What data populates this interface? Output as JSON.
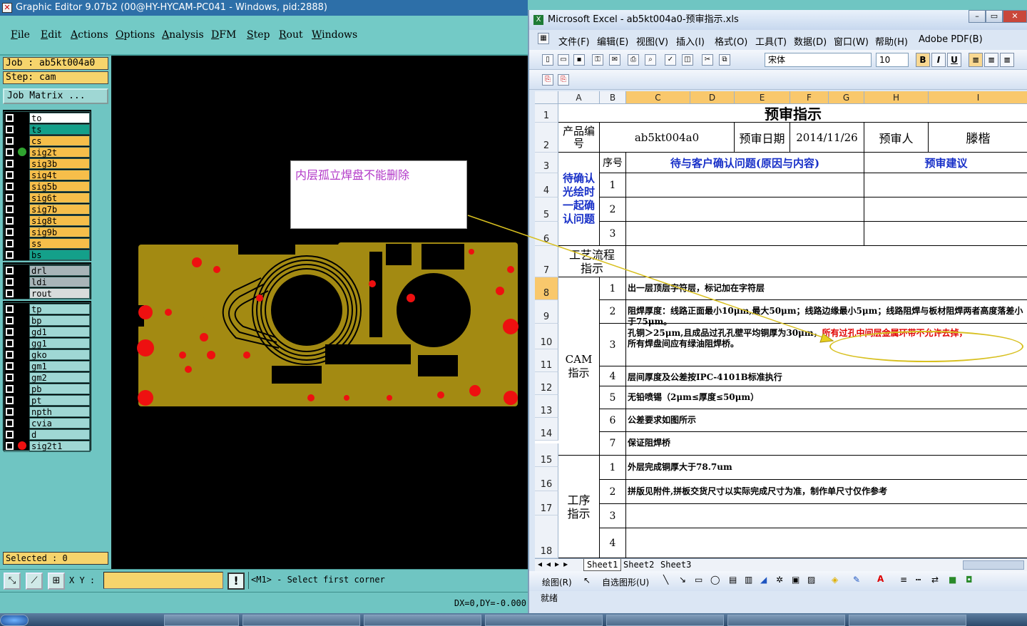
{
  "ge": {
    "title": "Graphic Editor 9.07b2 (00@HY-HYCAM-PC041 - Windows, pid:2888)",
    "menu": [
      "File",
      "Edit",
      "Actions",
      "Options",
      "Analysis",
      "DFM",
      "Step",
      "Rout",
      "Windows"
    ],
    "job": "Job : ab5kt004a0",
    "step": "Step: cam",
    "job_matrix": "Job Matrix ...",
    "layers_board": [
      {
        "name": "to",
        "color": "#ffffff"
      },
      {
        "name": "ts",
        "color": "#14a08a"
      },
      {
        "name": "cs",
        "color": "#f6be4a"
      },
      {
        "name": "sig2t",
        "color": "#f6be4a",
        "dot": "#2fa32f"
      },
      {
        "name": "sig3b",
        "color": "#f6be4a"
      },
      {
        "name": "sig4t",
        "color": "#f6be4a"
      },
      {
        "name": "sig5b",
        "color": "#f6be4a"
      },
      {
        "name": "sig6t",
        "color": "#f6be4a"
      },
      {
        "name": "sig7b",
        "color": "#f6be4a"
      },
      {
        "name": "sig8t",
        "color": "#f6be4a"
      },
      {
        "name": "sig9b",
        "color": "#f6be4a"
      },
      {
        "name": "ss",
        "color": "#f6be4a"
      },
      {
        "name": "bs",
        "color": "#14a08a"
      }
    ],
    "layers_drill": [
      {
        "name": "drl",
        "color": "#a8b4b8"
      },
      {
        "name": "ldi",
        "color": "#a8b4b8"
      },
      {
        "name": "rout",
        "color": "#d8dcdc"
      }
    ],
    "layers_misc": [
      {
        "name": "tp",
        "color": "#9fd7d4"
      },
      {
        "name": "bp",
        "color": "#9fd7d4"
      },
      {
        "name": "gd1",
        "color": "#9fd7d4"
      },
      {
        "name": "gg1",
        "color": "#9fd7d4"
      },
      {
        "name": "gko",
        "color": "#9fd7d4"
      },
      {
        "name": "gm1",
        "color": "#9fd7d4"
      },
      {
        "name": "gm2",
        "color": "#9fd7d4"
      },
      {
        "name": "pb",
        "color": "#9fd7d4"
      },
      {
        "name": "pt",
        "color": "#9fd7d4"
      },
      {
        "name": "npth",
        "color": "#9fd7d4"
      },
      {
        "name": "cvia",
        "color": "#9fd7d4"
      },
      {
        "name": "d",
        "color": "#9fd7d4"
      },
      {
        "name": "sig2t1",
        "color": "#9fd7d4",
        "dot": "#ee1010"
      }
    ],
    "selected": "Selected : 0",
    "annotation": "内层孤立焊盘不能删除",
    "xy_label": "X Y :",
    "prompt": "<M1> - Select first corner",
    "dxdy": "DX=0,DY=-0.000"
  },
  "xl": {
    "title": "Microsoft Excel - ab5kt004a0-预审指示.xls",
    "menu": [
      "文件(F)",
      "编辑(E)",
      "视图(V)",
      "插入(I)",
      "格式(O)",
      "工具(T)",
      "数据(D)",
      "窗口(W)",
      "帮助(H)",
      "Adobe PDF(B)"
    ],
    "font": "宋体",
    "size": "10",
    "columns": [
      "A",
      "B",
      "C",
      "D",
      "E",
      "F",
      "G",
      "H",
      "I"
    ],
    "rows": [
      "1",
      "2",
      "3",
      "4",
      "5",
      "6",
      "7",
      "8",
      "9",
      "10",
      "11",
      "12",
      "13",
      "14",
      "15",
      "16",
      "17",
      "18"
    ],
    "sheet": {
      "title": "预审指示",
      "product_label": "产品编号",
      "product_no": "ab5kt004a0",
      "date_label": "预审日期",
      "date": "2014/11/26",
      "reviewer_label": "预审人",
      "reviewer": "滕楷",
      "seq_label": "序号",
      "issue_header": "待与客户确认问题(原因与内容)",
      "suggest_header": "预审建议",
      "confirm_label": "待确认光绘时一起确认问题",
      "confirm_nums": [
        "1",
        "2",
        "3"
      ],
      "process_label": "工艺流程指示",
      "cam_label": "CAM指示",
      "cam_items": [
        {
          "n": "1",
          "t": "出一层顶层字符层，标记加在字符层"
        },
        {
          "n": "2",
          "t": "阻焊厚度：线路正面最小10μm,最大50μm；线路边缘最小5μm；线路阻焊与板材阻焊两者高度落差小于75μm。"
        },
        {
          "n": "3",
          "t": "孔铜＞25μm,且成品过孔孔壁平均铜厚为30μm，",
          "t_red": "所有过孔中间层金属环带不允许去掉，",
          "t2": "所有焊盘间应有绿油阻焊桥。"
        },
        {
          "n": "4",
          "t": "层间厚度及公差按IPC-4101B标准执行"
        },
        {
          "n": "5",
          "t": "无铅喷锡（2μm≤厚度≤50μm）"
        },
        {
          "n": "6",
          "t": "公差要求如图所示"
        },
        {
          "n": "7",
          "t": "保证阻焊桥"
        }
      ],
      "proc_label": "工序指示",
      "proc_items": [
        {
          "n": "1",
          "t": "外层完成铜厚大于78.7um"
        },
        {
          "n": "2",
          "t": "拼版见附件,拼板交货尺寸以实际完成尺寸为准，制作单尺寸仅作参考"
        },
        {
          "n": "3",
          "t": ""
        },
        {
          "n": "4",
          "t": ""
        }
      ]
    },
    "tabs": [
      "Sheet1",
      "Sheet2",
      "Sheet3"
    ],
    "draw": "绘图(R)",
    "autoshape": "自选图形(U)",
    "status": "就绪"
  }
}
